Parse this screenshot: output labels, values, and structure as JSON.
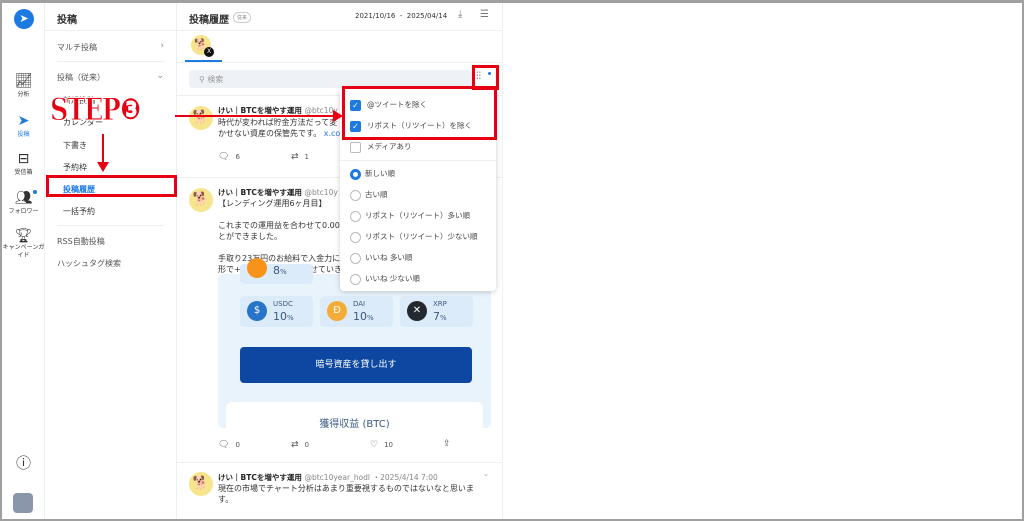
{
  "rail": {
    "items": [
      {
        "label": "分析"
      },
      {
        "label": "投稿"
      },
      {
        "label": "受信箱"
      },
      {
        "label": "フォロワー"
      },
      {
        "label": "キャンペーンガイド"
      }
    ]
  },
  "sidebar": {
    "title": "投稿",
    "items": [
      {
        "label": "マルチ投稿"
      },
      {
        "label": "投稿（従来）"
      },
      {
        "label": "新規投稿"
      },
      {
        "label": "カレンダー"
      },
      {
        "label": "下書き"
      },
      {
        "label": "予約枠"
      },
      {
        "label": "投稿履歴"
      },
      {
        "label": "一括予約"
      },
      {
        "label": "RSS自動投稿"
      },
      {
        "label": "ハッシュタグ検索"
      }
    ]
  },
  "header": {
    "title": "投稿履歴",
    "badge": "従来",
    "date_from": "2021/10/16",
    "date_sep": "-",
    "date_to": "2025/04/14"
  },
  "search": {
    "placeholder": "検索"
  },
  "filter": {
    "checkboxes": [
      {
        "label": "@ツイートを除く",
        "checked": true
      },
      {
        "label": "リポスト（リツイート）を除く",
        "checked": true
      },
      {
        "label": "メディアあり",
        "checked": false
      }
    ],
    "sort": [
      {
        "label": "新しい順",
        "selected": true
      },
      {
        "label": "古い順"
      },
      {
        "label": "リポスト（リツイート）多い順"
      },
      {
        "label": "リポスト（リツイート）少ない順"
      },
      {
        "label": "いいね 多い順"
      },
      {
        "label": "いいね 少ない順"
      }
    ]
  },
  "posts": [
    {
      "name": "けい｜BTCを増やす運用",
      "handle": "@btc10y",
      "line1": "時代が変われば貯金方法だって変",
      "line2": "かせない資産の保管先です。",
      "link": "x.co",
      "replies": "6",
      "reposts": "1"
    },
    {
      "name": "けい｜BTCを増やす運用",
      "handle": "@btc10y",
      "text1": "【レンディング運用6ヶ月目】",
      "text2": "これまでの運用益を合わせて0.00",
      "text3": "とができました。",
      "text4": "手取り23万円のお給料で入金力に",
      "text5": "形で+αの枚数を毎月増やせていき",
      "card": {
        "top_pct": "8",
        "coins": [
          {
            "name": "USDC",
            "pct": "10"
          },
          {
            "name": "DAI",
            "pct": "10"
          },
          {
            "name": "XRP",
            "pct": "7"
          }
        ],
        "pct_unit": "%",
        "button": "暗号資産を貸し出す",
        "earn_title": "獲得収益 (BTC)"
      },
      "replies": "0",
      "reposts": "0",
      "likes": "10"
    },
    {
      "name": "けい｜BTCを増やす運用",
      "handle": "@btc10year_hodl",
      "time": "・2025/4/14 7:00",
      "text1": "現在の市場でチャート分析はあまり重要視するものではないなと思いま",
      "text2": "す。"
    }
  ],
  "annotation": {
    "step": "STEP❸"
  },
  "colors": {
    "accent": "#1d7ae0",
    "annotation": "#e60012",
    "button": "#0d47a1"
  }
}
